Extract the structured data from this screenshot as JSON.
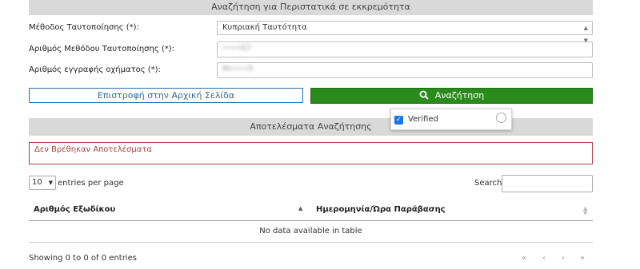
{
  "search_section": {
    "title": "Αναζήτηση για Περιστατικά σε εκκρεμότητα"
  },
  "form": {
    "method_label": "Μέθοδος Ταυτοποίησης (*):",
    "method_value": "Κυπριακή Ταυτότητα",
    "id_number_label": "Αριθμός Μεθόδου Ταυτοποίησης (*):",
    "id_number_value": "••••67",
    "plate_label": "Αριθμός εγγραφής οχήματος (*):",
    "plate_value": "M••••5"
  },
  "buttons": {
    "home": "Επιστροφή στην Αρχική Σελίδα",
    "search": "Αναζήτηση"
  },
  "captcha": {
    "label": "Verified",
    "checked": true
  },
  "results_section": {
    "title": "Αποτελέσματα Αναζήτησης"
  },
  "alert": {
    "message": "Δεν Βρέθηκαν Αποτελέσματα"
  },
  "table_controls": {
    "page_size": "10",
    "entries_label": "entries per page",
    "search_label": "Search:"
  },
  "table": {
    "columns": [
      "Αριθμός Εξωδίκου",
      "Ημερομηνία/Ώρα Παράβασης"
    ],
    "empty_message": "No data available in table"
  },
  "footer": {
    "info": "Showing 0 to 0 of 0 entries",
    "pager": [
      "«",
      "‹",
      "›",
      "»"
    ]
  },
  "colors": {
    "search_button": "#2a8a1c",
    "home_button_border": "#2e6da4",
    "alert": "#a94442",
    "section_bar": "#d9d9d9"
  }
}
